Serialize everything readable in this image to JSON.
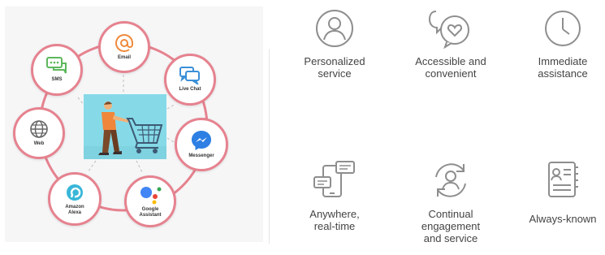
{
  "diagram": {
    "channels": [
      {
        "id": "email",
        "label": "Email",
        "icon": "email-at-icon",
        "color": "#f08a3c"
      },
      {
        "id": "live_chat",
        "label": "Live Chat",
        "icon": "chat-bubbles-icon",
        "color": "#3a8fd8"
      },
      {
        "id": "messenger",
        "label": "Messenger",
        "icon": "messenger-icon",
        "color": "#2d7fe3"
      },
      {
        "id": "google_assistant",
        "label_line1": "Google",
        "label_line2": "Assistant",
        "icon": "google-assistant-icon"
      },
      {
        "id": "amazon_alexa",
        "label_line1": "Amazon",
        "label_line2": "Alexa",
        "icon": "alexa-icon",
        "color": "#38b6d8"
      },
      {
        "id": "web",
        "label": "Web",
        "icon": "globe-icon",
        "color": "#666666"
      },
      {
        "id": "sms",
        "label": "SMS",
        "icon": "sms-icon",
        "color": "#5cb85c"
      }
    ],
    "center_image": "shopper-with-cart"
  },
  "features": [
    {
      "icon": "person-icon",
      "line1": "Personalized",
      "line2": "service"
    },
    {
      "icon": "chat-heart-icon",
      "line1": "Accessible and",
      "line2": "convenient"
    },
    {
      "icon": "clock-icon",
      "line1": "Immediate",
      "line2": "assistance"
    },
    {
      "icon": "devices-chat-icon",
      "line1": "Anywhere,",
      "line2": "real-time"
    },
    {
      "icon": "person-cycle-icon",
      "line1": "Continual",
      "line2": "engagement",
      "line3": "and service"
    },
    {
      "icon": "profile-card-icon",
      "line1": "Always-known"
    }
  ],
  "colors": {
    "ring": "#e6828f",
    "icon_gray": "#8e8e8e",
    "shopper_bg": "#86dae8"
  }
}
